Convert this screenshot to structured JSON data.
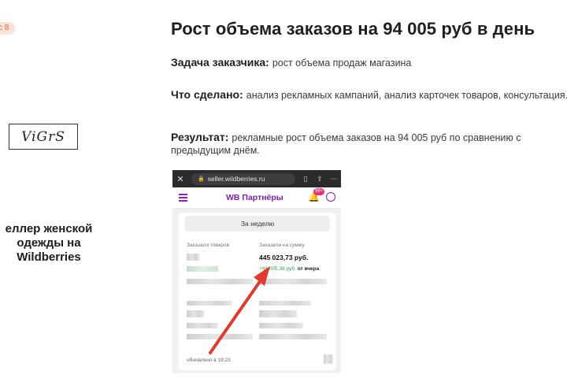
{
  "left": {
    "badge": "с 8",
    "logo_text": "ViGrS",
    "seller_name": "еллер женской одежды на Wildberries"
  },
  "main": {
    "title": "Рост объема заказов на 94 005 руб в день",
    "task_label": "Задача заказчика:",
    "task_text": "рост объема продаж магазина",
    "done_label": "Что сделано:",
    "done_text": "анализ рекламных кампаний, анализ карточек товаров, консультация.",
    "result_label": "Результат:",
    "result_text": "рекламные рост объема заказов на 94 005 руб по сравнению с предыдущим днём."
  },
  "phone": {
    "url": "seller.wildberries.ru",
    "app_title": "WB Партнёры",
    "notif_count": "99+",
    "period_button": "За неделю",
    "orders_label": "Заказали товаров",
    "sum_label": "Заказали на сумму",
    "sum_value": "445 023,73 руб.",
    "delta_value": "+94 005,38 руб.",
    "delta_suffix": "от вчера",
    "updated": "обновлено в 19:23",
    "arrow_color": "#e03a2f"
  }
}
